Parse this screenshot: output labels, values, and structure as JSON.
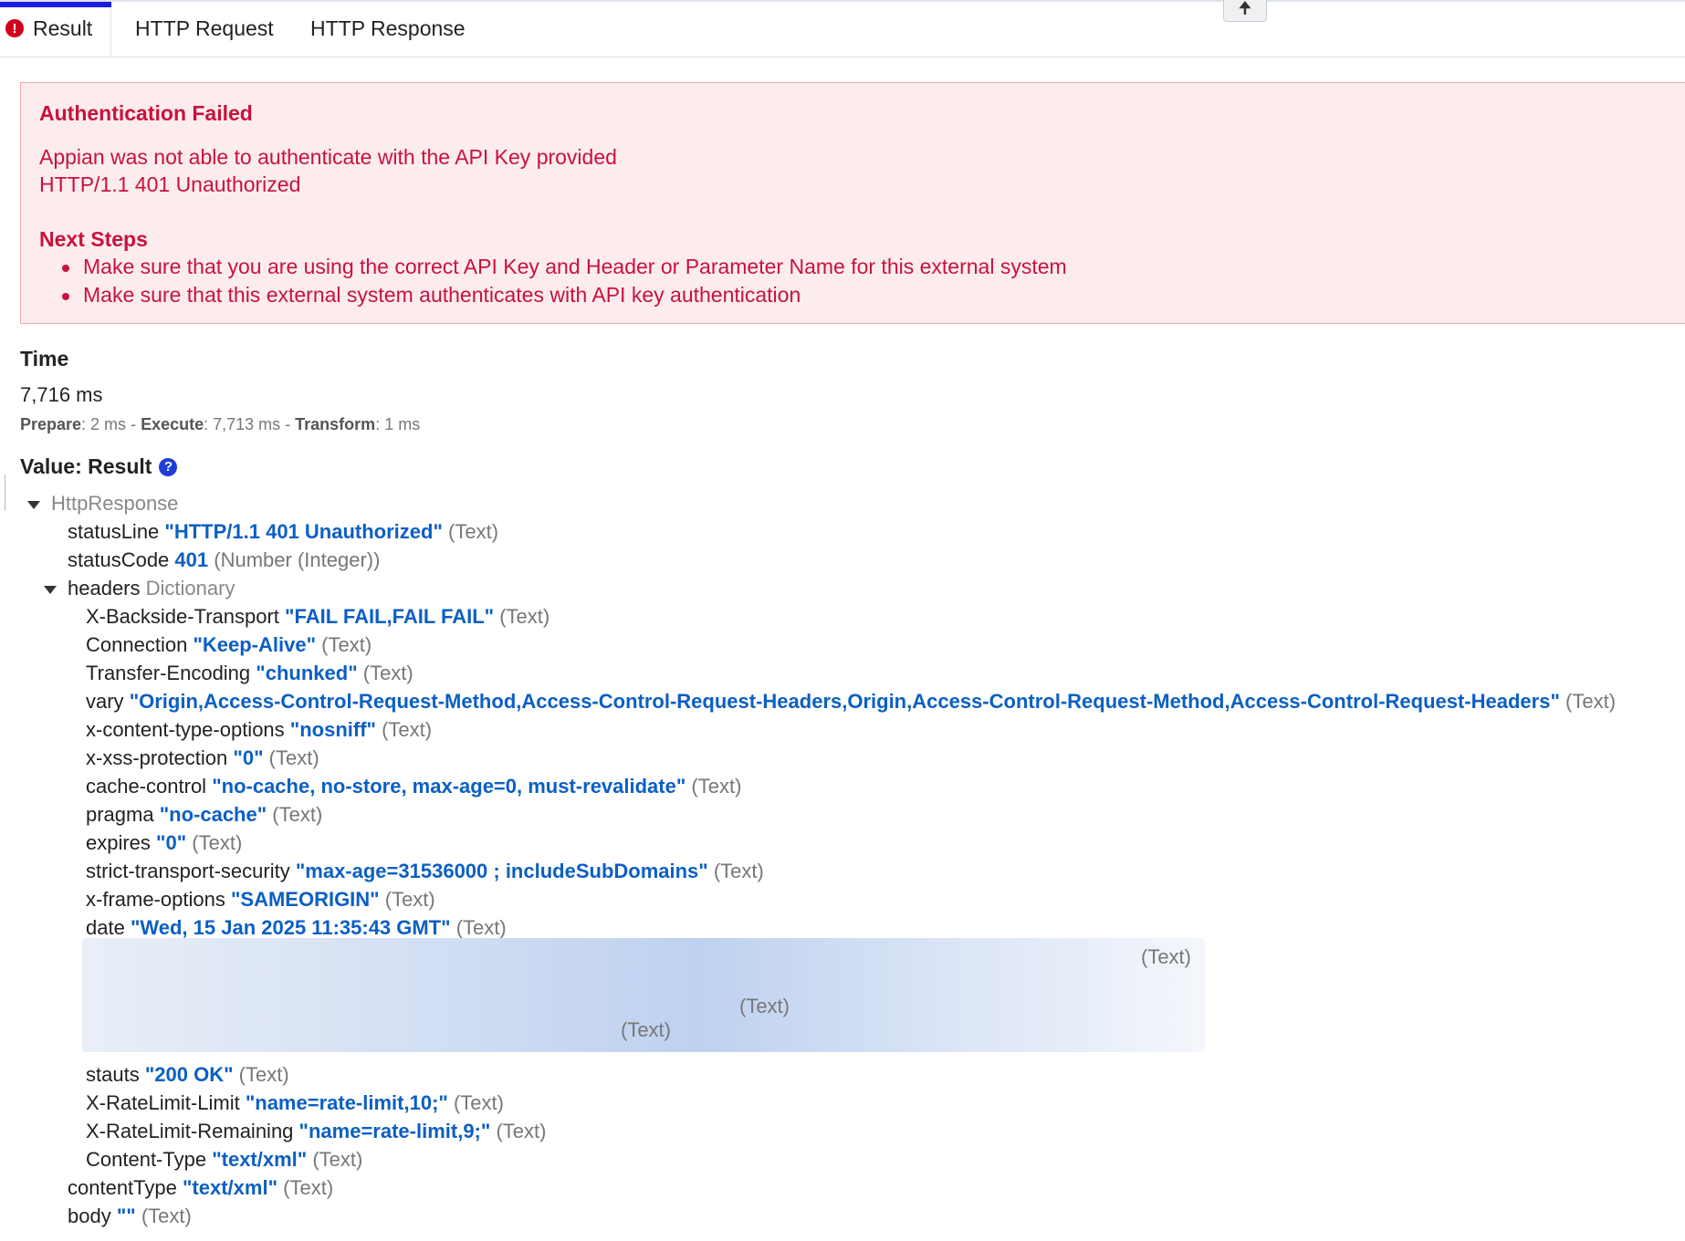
{
  "tabs": [
    {
      "label": "Result"
    },
    {
      "label": "HTTP Request"
    },
    {
      "label": "HTTP Response"
    }
  ],
  "alert": {
    "title": "Authentication Failed",
    "message_lines": [
      "Appian was not able to authenticate with the API Key provided",
      "HTTP/1.1 401 Unauthorized"
    ],
    "next_steps_title": "Next Steps",
    "steps": [
      "Make sure that you are using the correct API Key and Header or Parameter Name for this external system",
      "Make sure that this external system authenticates with API key authentication"
    ]
  },
  "time": {
    "heading": "Time",
    "total": "7,716 ms",
    "prepare_label": "Prepare",
    "prepare_value": ": 2 ms",
    "execute_label": "Execute",
    "execute_value": ": 7,713 ms",
    "transform_label": "Transform",
    "transform_value": ": 1 ms",
    "separator": " - "
  },
  "value": {
    "heading": "Value: Result",
    "root": "HttpResponse",
    "statusLine": {
      "key": "statusLine",
      "value": "\"HTTP/1.1 401 Unauthorized\"",
      "type": "(Text)"
    },
    "statusCode": {
      "key": "statusCode",
      "value": "401",
      "type": "(Number (Integer))"
    },
    "headers_key": "headers",
    "headers_type": "Dictionary",
    "headers": [
      {
        "key": "X-Backside-Transport",
        "value": "\"FAIL FAIL,FAIL FAIL\"",
        "type": "(Text)"
      },
      {
        "key": "Connection",
        "value": "\"Keep-Alive\"",
        "type": "(Text)"
      },
      {
        "key": "Transfer-Encoding",
        "value": "\"chunked\"",
        "type": "(Text)"
      },
      {
        "key": "vary",
        "value": "\"Origin,Access-Control-Request-Method,Access-Control-Request-Headers,Origin,Access-Control-Request-Method,Access-Control-Request-Headers\"",
        "type": "(Text)"
      },
      {
        "key": "x-content-type-options",
        "value": "\"nosniff\"",
        "type": "(Text)"
      },
      {
        "key": "x-xss-protection",
        "value": "\"0\"",
        "type": "(Text)"
      },
      {
        "key": "cache-control",
        "value": "\"no-cache, no-store, max-age=0, must-revalidate\"",
        "type": "(Text)"
      },
      {
        "key": "pragma",
        "value": "\"no-cache\"",
        "type": "(Text)"
      },
      {
        "key": "expires",
        "value": "\"0\"",
        "type": "(Text)"
      },
      {
        "key": "strict-transport-security",
        "value": "\"max-age=31536000 ; includeSubDomains\"",
        "type": "(Text)"
      },
      {
        "key": "x-frame-options",
        "value": "\"SAMEORIGIN\"",
        "type": "(Text)"
      },
      {
        "key": "date",
        "value": "\"Wed, 15 Jan 2025 11:35:43 GMT\"",
        "type": "(Text)"
      }
    ],
    "redacted_types": [
      "(Text)",
      "(Text)",
      "(Text)"
    ],
    "headers_after": [
      {
        "key": "stauts",
        "value": "\"200 OK\"",
        "type": "(Text)"
      },
      {
        "key": "X-RateLimit-Limit",
        "value": "\"name=rate-limit,10;\"",
        "type": "(Text)"
      },
      {
        "key": "X-RateLimit-Remaining",
        "value": "\"name=rate-limit,9;\"",
        "type": "(Text)"
      },
      {
        "key": "Content-Type",
        "value": "\"text/xml\"",
        "type": "(Text)"
      }
    ],
    "contentType": {
      "key": "contentType",
      "value": "\"text/xml\"",
      "type": "(Text)"
    },
    "body": {
      "key": "body",
      "value": "\"\"",
      "type": "(Text)"
    }
  }
}
